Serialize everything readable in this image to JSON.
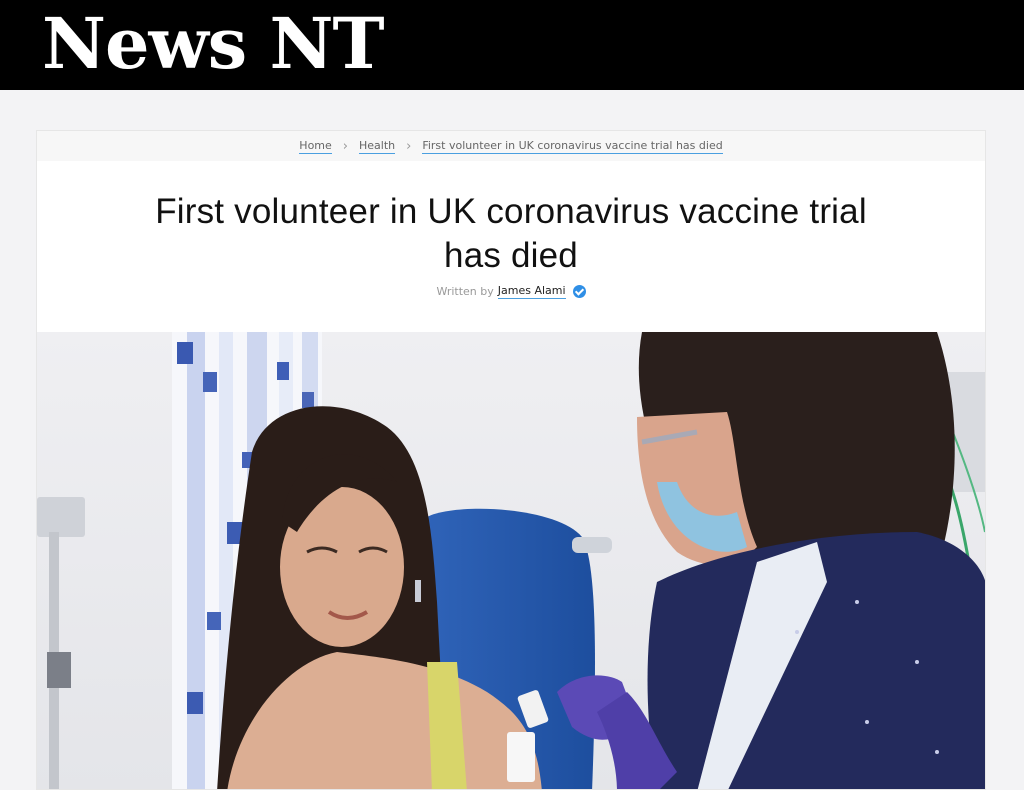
{
  "site": {
    "logo": "News NT"
  },
  "breadcrumb": {
    "items": [
      "Home",
      "Health",
      "First volunteer in UK coronavirus vaccine trial has died"
    ]
  },
  "article": {
    "title": "First volunteer in UK coronavirus vaccine trial has died",
    "written_by_label": "Written by",
    "author": "James Alami"
  },
  "icons": {
    "separator": "chevron-right-icon",
    "verified": "verified-check-icon"
  },
  "colors": {
    "topbar": "#000000",
    "link_underline": "#4a9fe0",
    "verified": "#2f8fe6"
  }
}
